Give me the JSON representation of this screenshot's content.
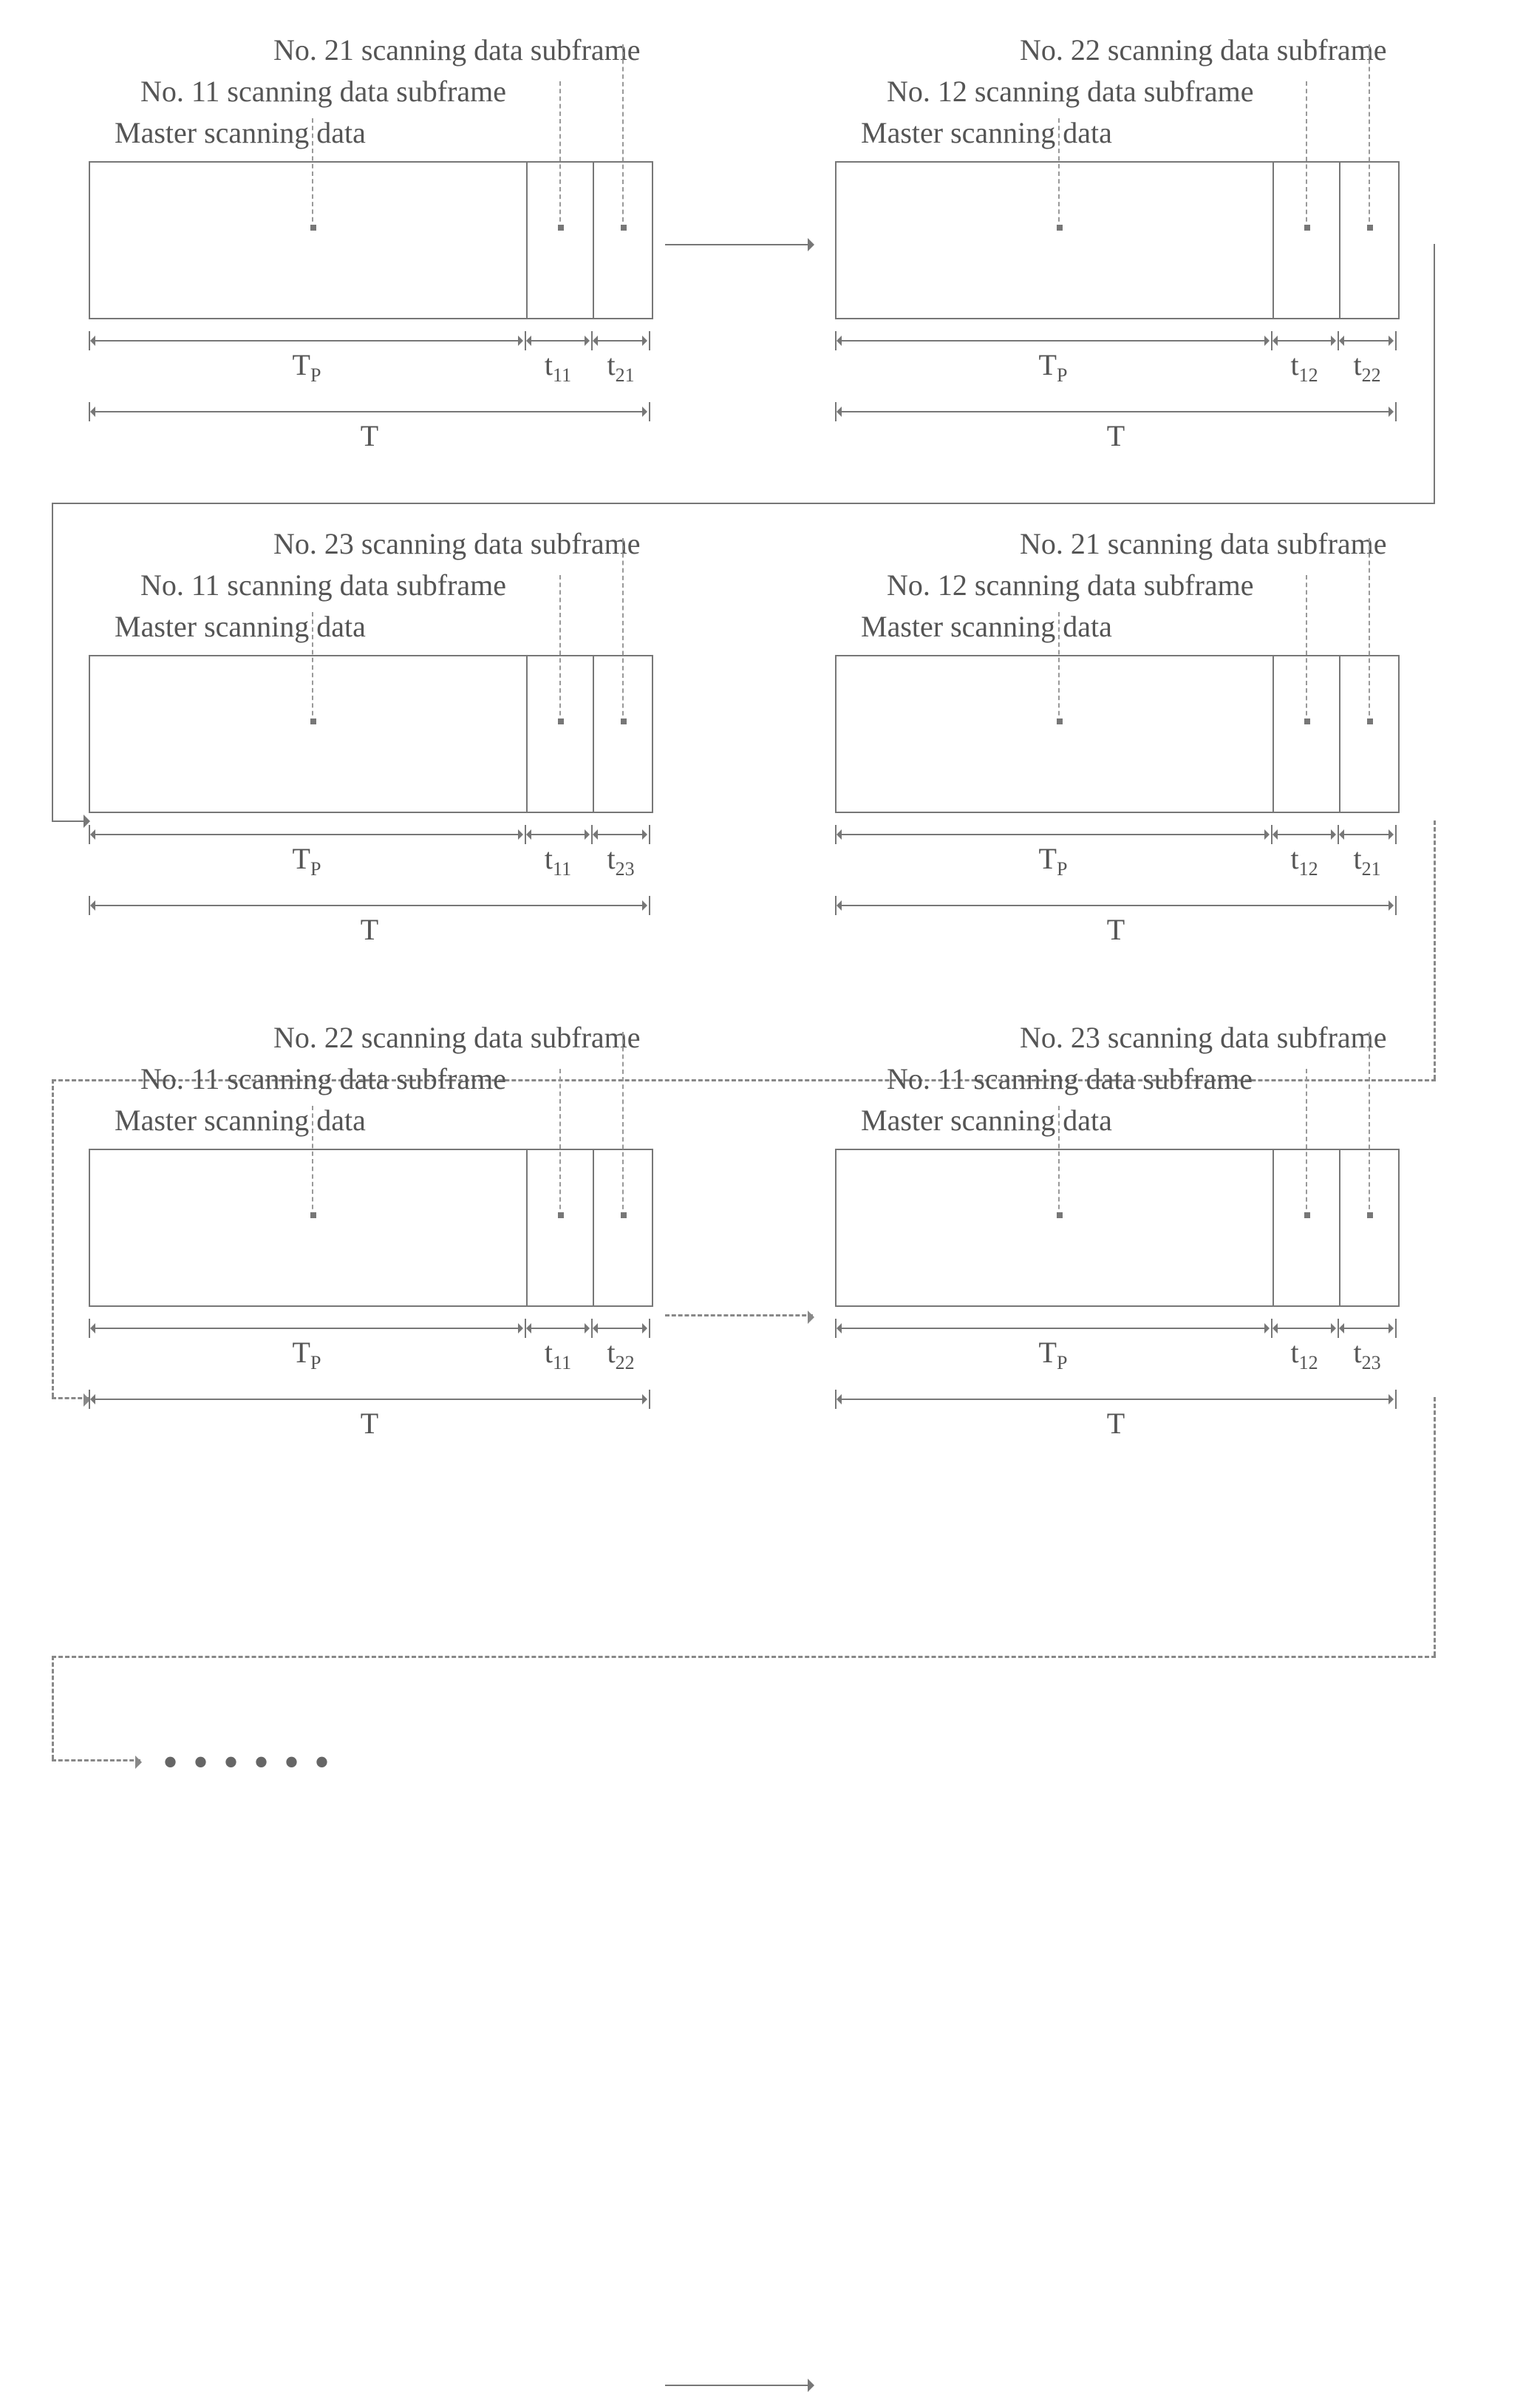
{
  "common": {
    "master": "Master scanning data",
    "tp": "T",
    "tp_sub": "P",
    "T": "T"
  },
  "frames": [
    {
      "topLabel": "No. 21 scanning data subframe",
      "midLabel": "No. 11 scanning data subframe",
      "t1": "t",
      "t1s": "11",
      "t2": "t",
      "t2s": "21"
    },
    {
      "topLabel": "No. 22 scanning data subframe",
      "midLabel": "No. 12 scanning data subframe",
      "t1": "t",
      "t1s": "12",
      "t2": "t",
      "t2s": "22"
    },
    {
      "topLabel": "No. 23 scanning data subframe",
      "midLabel": "No. 11 scanning data subframe",
      "t1": "t",
      "t1s": "11",
      "t2": "t",
      "t2s": "23"
    },
    {
      "topLabel": "No. 21 scanning data subframe",
      "midLabel": "No. 12 scanning data subframe",
      "t1": "t",
      "t1s": "12",
      "t2": "t",
      "t2s": "21"
    },
    {
      "topLabel": "No. 22 scanning data subframe",
      "midLabel": "No. 11 scanning data subframe",
      "t1": "t",
      "t1s": "11",
      "t2": "t",
      "t2s": "22"
    },
    {
      "topLabel": "No. 23 scanning data subframe",
      "midLabel": "No. 11 scanning data subframe",
      "t1": "t",
      "t1s": "12",
      "t2": "t",
      "t2s": "23"
    }
  ]
}
